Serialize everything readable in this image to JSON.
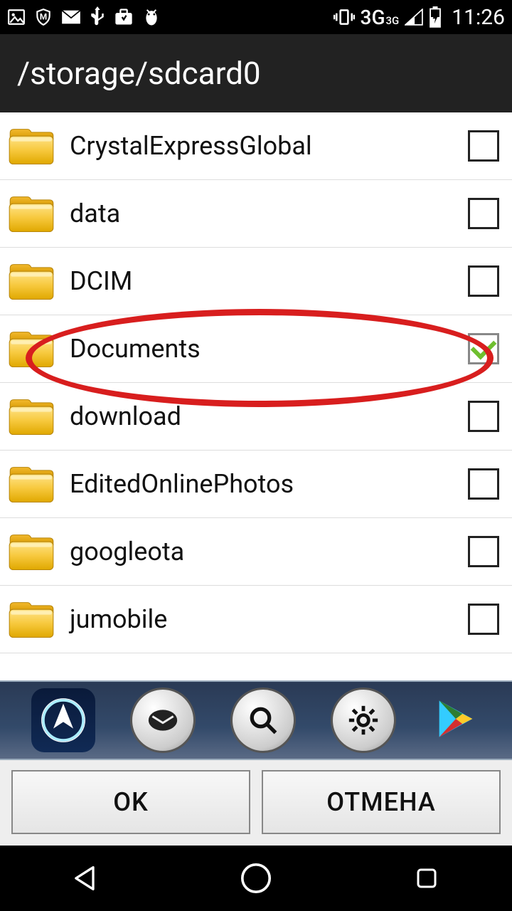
{
  "statusbar": {
    "clock": "11:26",
    "network_label": "3G",
    "network_sup": "3G"
  },
  "header": {
    "path": "/storage/sdcard0"
  },
  "folders": [
    {
      "name": "CrystalExpressGlobal",
      "checked": false
    },
    {
      "name": "data",
      "checked": false
    },
    {
      "name": "DCIM",
      "checked": false
    },
    {
      "name": "Documents",
      "checked": true
    },
    {
      "name": "download",
      "checked": false
    },
    {
      "name": "EditedOnlinePhotos",
      "checked": false
    },
    {
      "name": "googleota",
      "checked": false
    },
    {
      "name": "jumobile",
      "checked": false
    }
  ],
  "buttons": {
    "ok": "OK",
    "cancel": "ОТМЕНА"
  },
  "annotation": {
    "highlighted_folder": "Documents"
  }
}
